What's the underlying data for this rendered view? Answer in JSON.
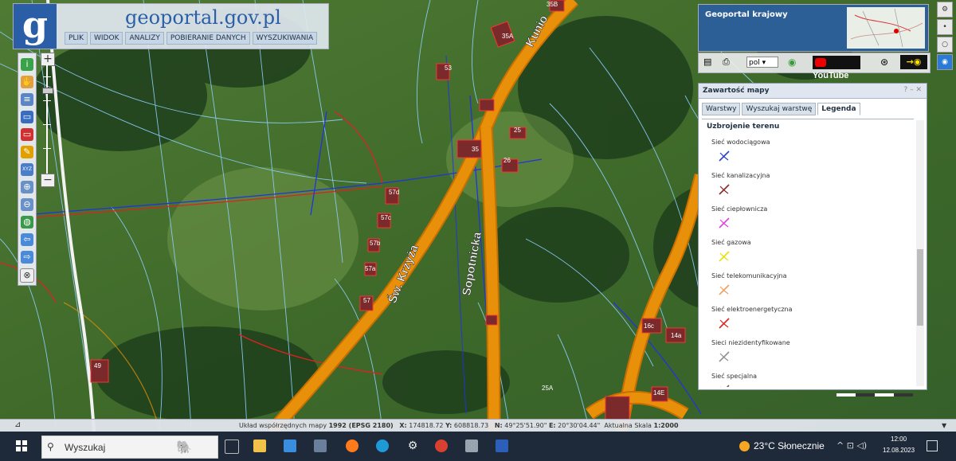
{
  "site": {
    "title_g": "g",
    "title_rest": "eoportal.gov.pl",
    "logo": "g"
  },
  "menu": [
    "PLIK",
    "WIDOK",
    "ANALIZY",
    "POBIERANIE DANYCH",
    "WYSZUKIWANIA"
  ],
  "overview": {
    "title": "Geoportal krajowy"
  },
  "tools": {
    "lang": "pol",
    "youtube": "YouTube"
  },
  "legend": {
    "title": "Zawartość mapy",
    "controls": "? – ✕",
    "tabs": [
      "Warstwy",
      "Wyszukaj warstwę",
      "Legenda"
    ],
    "active_tab": "Legenda",
    "section": "Uzbrojenie terenu",
    "items": [
      {
        "label": "Sieć wodociągowa",
        "color": "#2a3fd1"
      },
      {
        "label": "Sieć kanalizacyjna",
        "color": "#8b2a2a"
      },
      {
        "label": "Sieć ciepłownicza",
        "color": "#e040e0"
      },
      {
        "label": "Sieć gazowa",
        "color": "#e8e000"
      },
      {
        "label": "Sieć telekomunikacyjna",
        "color": "#f0a060"
      },
      {
        "label": "Sieć elektroenergetyczna",
        "color": "#e02020"
      },
      {
        "label": "Sieci niezidentyfikowane",
        "color": "#909090"
      },
      {
        "label": "Sieć specjalna",
        "color": "#606060"
      }
    ]
  },
  "map": {
    "streets": [
      "Św. Krzyża",
      "Sopotnicka",
      "Kunio"
    ],
    "parcels": [
      "35B",
      "35A",
      "53",
      "26",
      "25",
      "35",
      "57d",
      "57c",
      "57b",
      "57a",
      "57",
      "49",
      "16c",
      "14a",
      "14E",
      "25A"
    ]
  },
  "status": {
    "prefix": "Układ współrzędnych mapy ",
    "crs": "1992 (EPSG 2180)",
    "x_label": "X:",
    "x": "174818.72",
    "y_label": "Y:",
    "y": "608818.73",
    "n_label": "N:",
    "n": "49°25'51.90\"",
    "e_label": "E:",
    "e": "20°30'04.44\"",
    "scale_label": "Aktualna Skala ",
    "scale": "1:2000"
  },
  "taskbar": {
    "search": "Wyszukaj",
    "weather": "23°C Słonecznie",
    "time": "12:00",
    "date": "12.08.2023"
  },
  "colors": {
    "road": "#e8900a",
    "parcel_line": "#8fd0ff",
    "utility_blue": "#2233dd",
    "utility_red": "#dd2222",
    "header_blue": "#2a5fa8"
  }
}
